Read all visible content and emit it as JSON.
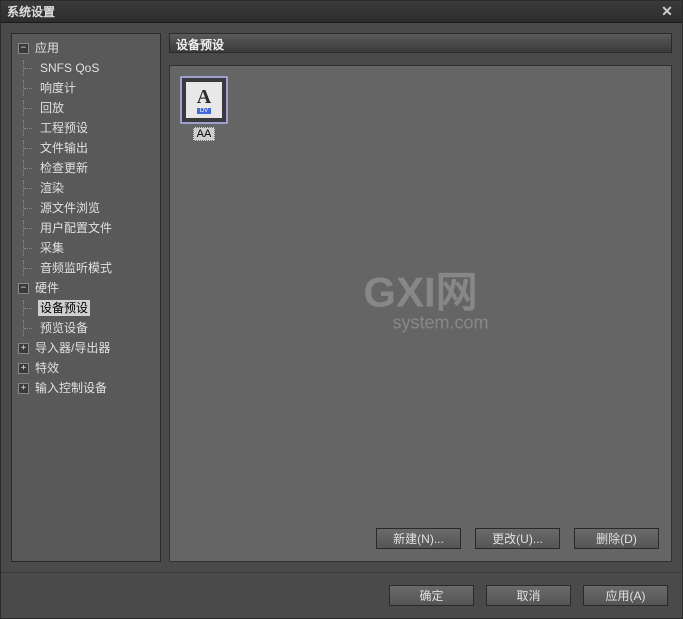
{
  "dialog": {
    "title": "系统设置"
  },
  "tree": {
    "application": {
      "label": "应用",
      "children": [
        "SNFS QoS",
        "响度计",
        "回放",
        "工程预设",
        "文件输出",
        "检查更新",
        "渲染",
        "源文件浏览",
        "用户配置文件",
        "采集",
        "音频监听模式"
      ]
    },
    "hardware": {
      "label": "硬件",
      "children": [
        "设备预设",
        "预览设备"
      ]
    },
    "importer": {
      "label": "导入器/导出器"
    },
    "effects": {
      "label": "特效"
    },
    "input": {
      "label": "输入控制设备"
    }
  },
  "section": {
    "title": "设备预设"
  },
  "preset": {
    "item_label": "AA",
    "item_dv": "DV"
  },
  "buttons": {
    "new": "新建(N)...",
    "change": "更改(U)...",
    "delete": "删除(D)"
  },
  "footer": {
    "ok": "确定",
    "cancel": "取消",
    "apply": "应用(A)"
  },
  "watermark": {
    "main": "GXI网",
    "sub": "system.com"
  }
}
